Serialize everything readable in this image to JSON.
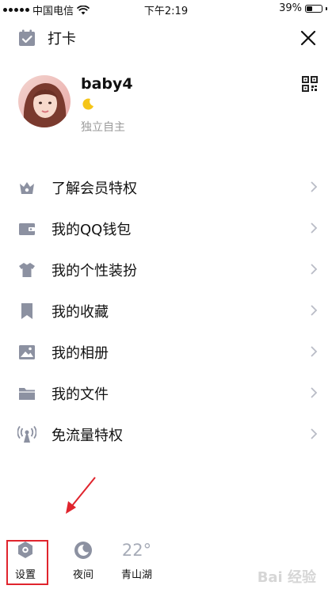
{
  "status_bar": {
    "carrier": "中国电信",
    "time": "下午2:19",
    "battery": "39%",
    "battery_level": 0.39
  },
  "checkin": {
    "label": "打卡"
  },
  "profile": {
    "nickname": "baby4",
    "signature": "独立自主"
  },
  "menu": {
    "items": [
      {
        "label": "了解会员特权",
        "icon": "vip-crown-icon"
      },
      {
        "label": "我的QQ钱包",
        "icon": "wallet-icon"
      },
      {
        "label": "我的个性装扮",
        "icon": "shirt-icon"
      },
      {
        "label": "我的收藏",
        "icon": "bookmark-icon"
      },
      {
        "label": "我的相册",
        "icon": "photo-album-icon"
      },
      {
        "label": "我的文件",
        "icon": "folder-icon"
      },
      {
        "label": "免流量特权",
        "icon": "signal-tower-icon"
      }
    ]
  },
  "bottom": {
    "settings_label": "设置",
    "night_label": "夜间",
    "temperature": "22°",
    "city": "青山湖"
  },
  "watermark": "Bai 经验",
  "colors": {
    "icon_gray": "#8c91a1",
    "highlight_red": "#e0242d",
    "moon_yellow": "#f5c518"
  }
}
